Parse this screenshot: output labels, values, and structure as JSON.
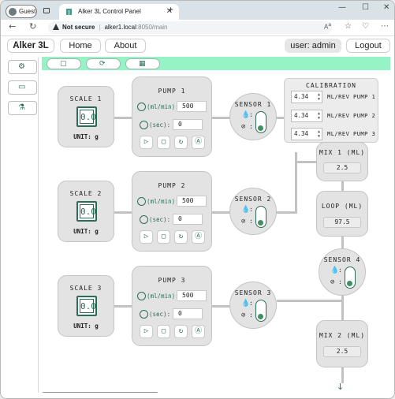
{
  "browser": {
    "profile": "Guest",
    "tab_title": "Alker 3L Control Panel",
    "security": "Not secure",
    "url_host": "alker1.local",
    "url_path": ":8050/main"
  },
  "nav": {
    "brand": "Alker 3L",
    "home": "Home",
    "about": "About",
    "user": "user: admin",
    "logout": "Logout"
  },
  "sidebar": [
    "gear-icon",
    "folder-icon",
    "flask-icon"
  ],
  "toolbar": [
    "stop-icon",
    "refresh-icon",
    "calculator-icon"
  ],
  "scales": [
    {
      "title": "SCALE 1",
      "display": "0.0",
      "unit": "UNIT: g"
    },
    {
      "title": "SCALE 2",
      "display": "0.0",
      "unit": "UNIT: g"
    },
    {
      "title": "SCALE 3",
      "display": "0.0",
      "unit": "UNIT: g"
    }
  ],
  "pump_labels": {
    "rate": "(ml/min):",
    "time": "(sec):"
  },
  "pumps": [
    {
      "title": "PUMP 1",
      "rate": "500",
      "time": "0"
    },
    {
      "title": "PUMP 2",
      "rate": "500",
      "time": "0"
    },
    {
      "title": "PUMP 3",
      "rate": "500",
      "time": "0"
    }
  ],
  "sensors": [
    {
      "title": "SENSOR 1",
      "state": "on"
    },
    {
      "title": "SENSOR 2",
      "state": "on"
    },
    {
      "title": "SENSOR 3",
      "state": "on"
    },
    {
      "title": "SENSOR 4",
      "state": "on"
    }
  ],
  "calibration": {
    "title": "CALIBRATION",
    "rows": [
      {
        "value": "4.34",
        "label": "ML/REV PUMP 1"
      },
      {
        "value": "4.34",
        "label": "ML/REV PUMP 2"
      },
      {
        "value": "4.34",
        "label": "ML/REV PUMP 3"
      }
    ]
  },
  "mix1": {
    "title": "MIX 1 (ML)",
    "value": "2.5"
  },
  "loop": {
    "title": "LOOP (ML)",
    "value": "97.5"
  },
  "mix2": {
    "title": "MIX 2 (ML)",
    "value": "2.5"
  },
  "colors": {
    "accent": "#2e6d55",
    "mint": "#95f3c5",
    "card": "#e3e3e3"
  }
}
